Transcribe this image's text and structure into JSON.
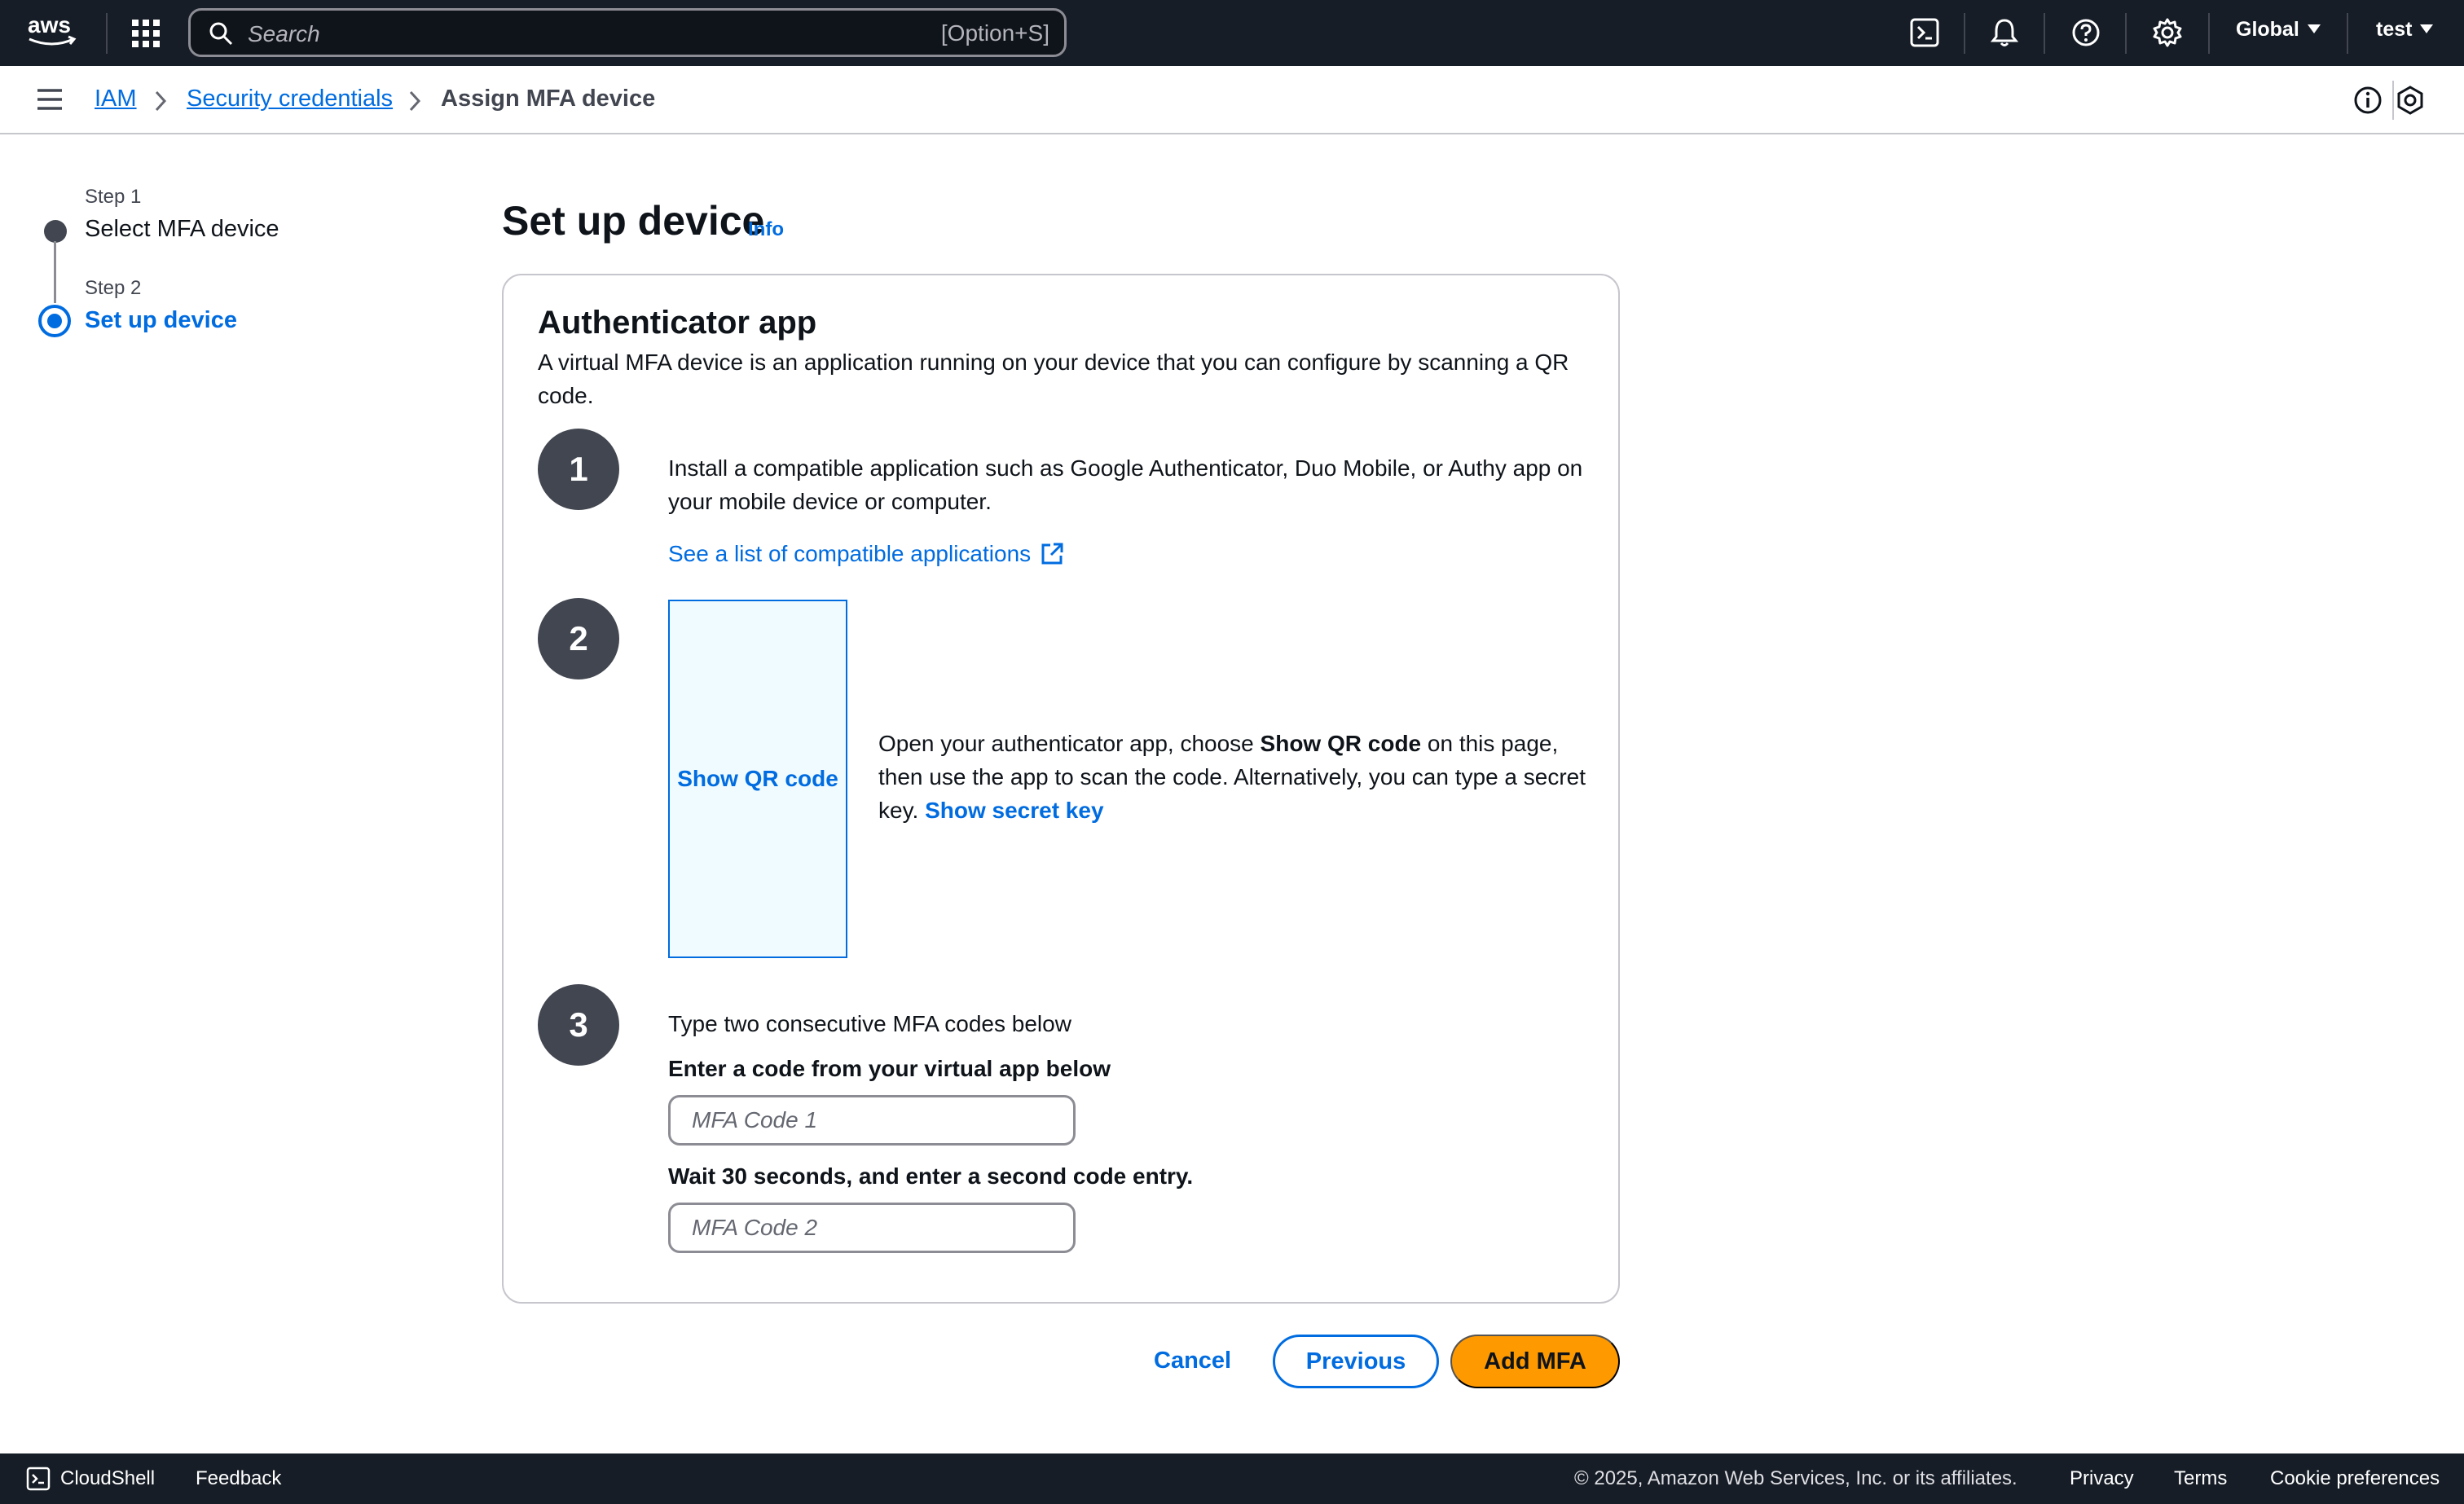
{
  "topnav": {
    "search_placeholder": "Search",
    "search_shortcut": "[Option+S]",
    "region": "Global",
    "user": "test"
  },
  "breadcrumb": {
    "items": [
      "IAM",
      "Security credentials"
    ],
    "current": "Assign MFA device"
  },
  "steps": [
    {
      "label": "Step 1",
      "title": "Select MFA device",
      "state": "completed"
    },
    {
      "label": "Step 2",
      "title": "Set up device",
      "state": "current"
    }
  ],
  "main": {
    "title": "Set up device",
    "info_link": "Info"
  },
  "card": {
    "title": "Authenticator app",
    "description": "A virtual MFA device is an application running on your device that you can configure by scanning a QR code.",
    "step1": {
      "number": "1",
      "text": "Install a compatible application such as Google Authenticator, Duo Mobile, or Authy app on your mobile device or computer.",
      "link": "See a list of compatible applications"
    },
    "step2": {
      "number": "2",
      "qr_link": "Show QR code",
      "text_before": "Open your authenticator app, choose ",
      "text_bold": "Show QR code",
      "text_after": " on this page, then use the app to scan the code. Alternatively, you can type a secret key. ",
      "secret_link": "Show secret key"
    },
    "step3": {
      "number": "3",
      "intro": "Type two consecutive MFA codes below",
      "label1": "Enter a code from your virtual app below",
      "placeholder1": "MFA Code 1",
      "label2": "Wait 30 seconds, and enter a second code entry.",
      "placeholder2": "MFA Code 2"
    }
  },
  "actions": {
    "cancel": "Cancel",
    "previous": "Previous",
    "submit": "Add MFA"
  },
  "footer": {
    "cloudshell": "CloudShell",
    "feedback": "Feedback",
    "copyright": "© 2025, Amazon Web Services, Inc. or its affiliates.",
    "privacy": "Privacy",
    "terms": "Terms",
    "cookies": "Cookie preferences"
  },
  "colors": {
    "nav_bg": "#161d26",
    "link": "#006ce0",
    "primary_button": "#ff9900",
    "step_circle": "#424650",
    "qr_box_bg": "#f0fbff"
  },
  "icons": [
    "aws-logo",
    "apps-grid-icon",
    "search-icon",
    "cloudshell-icon",
    "bell-icon",
    "help-icon",
    "gear-icon",
    "menu-icon",
    "chevron-right-icon",
    "info-icon",
    "hexagon-icon",
    "external-link-icon"
  ]
}
